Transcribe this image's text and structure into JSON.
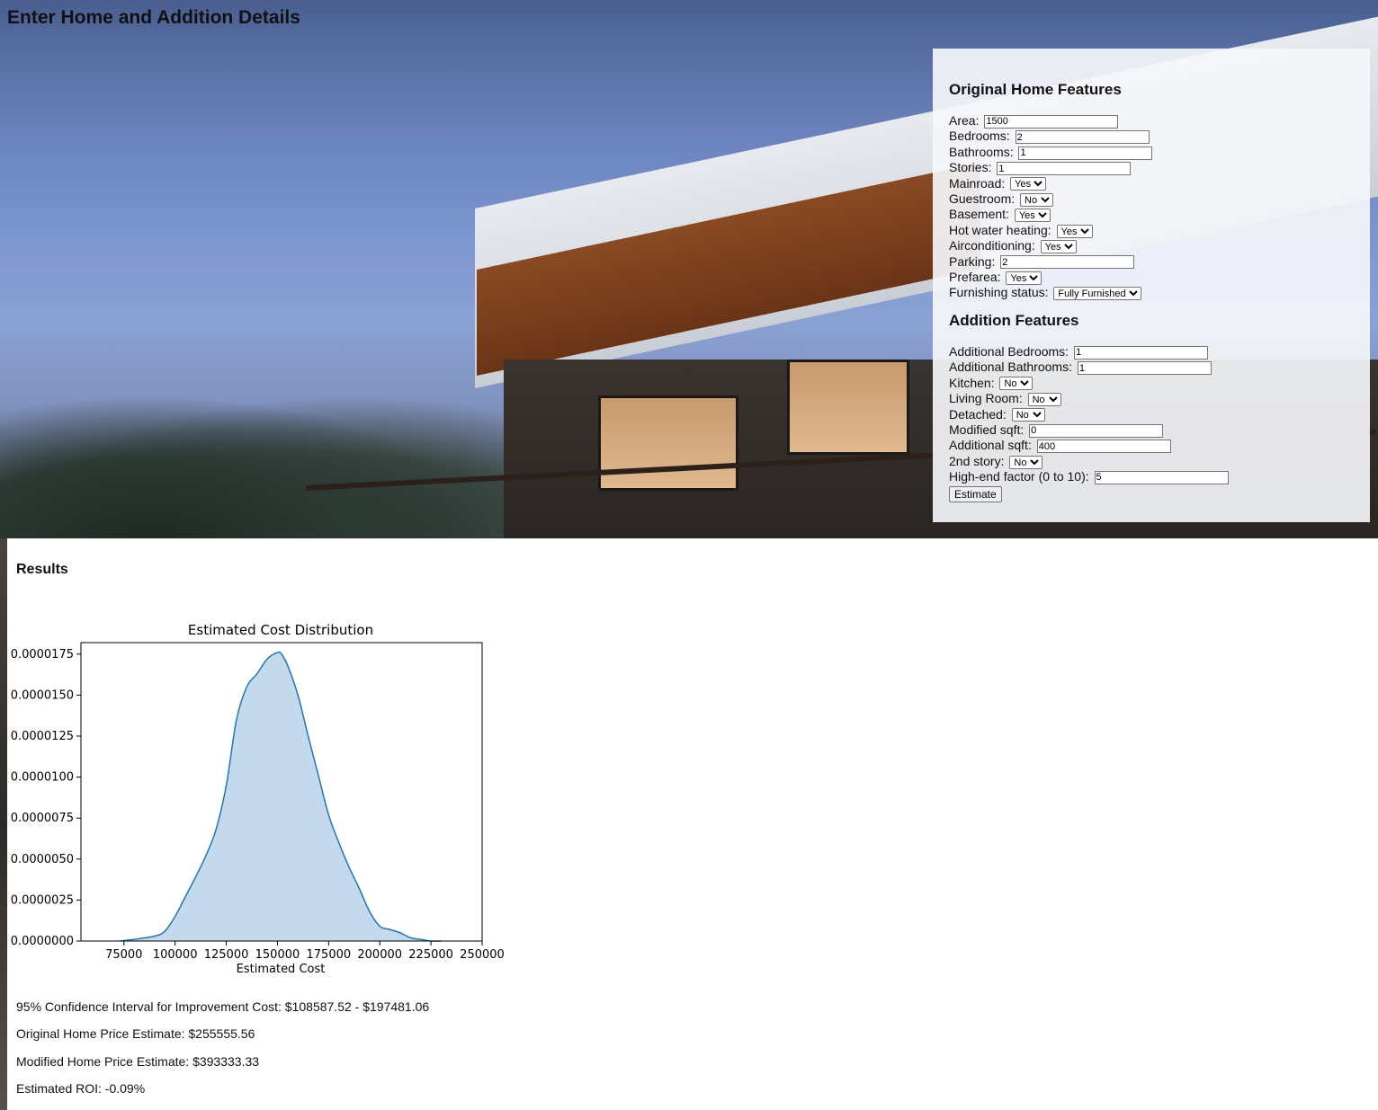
{
  "page": {
    "title": "Enter Home and Addition Details"
  },
  "original": {
    "heading": "Original Home Features",
    "fields": [
      {
        "label": "Area:",
        "type": "text",
        "value": "1500",
        "name": "area"
      },
      {
        "label": "Bedrooms:",
        "type": "text",
        "value": "2",
        "name": "bedrooms"
      },
      {
        "label": "Bathrooms:",
        "type": "text",
        "value": "1",
        "name": "bathrooms"
      },
      {
        "label": "Stories:",
        "type": "text",
        "value": "1",
        "name": "stories"
      },
      {
        "label": "Mainroad:",
        "type": "select",
        "value": "Yes",
        "name": "mainroad"
      },
      {
        "label": "Guestroom:",
        "type": "select",
        "value": "No",
        "name": "guestroom"
      },
      {
        "label": "Basement:",
        "type": "select",
        "value": "Yes",
        "name": "basement"
      },
      {
        "label": "Hot water heating:",
        "type": "select",
        "value": "Yes",
        "name": "hot-water-heating"
      },
      {
        "label": "Airconditioning:",
        "type": "select",
        "value": "Yes",
        "name": "airconditioning"
      },
      {
        "label": "Parking:",
        "type": "text",
        "value": "2",
        "name": "parking"
      },
      {
        "label": "Prefarea:",
        "type": "select",
        "value": "Yes",
        "name": "prefarea"
      },
      {
        "label": "Furnishing status:",
        "type": "select",
        "value": "Fully Furnished",
        "name": "furnishing-status"
      }
    ]
  },
  "addition": {
    "heading": "Addition Features",
    "fields": [
      {
        "label": "Additional Bedrooms:",
        "type": "text",
        "value": "1",
        "name": "additional-bedrooms"
      },
      {
        "label": "Additional Bathrooms:",
        "type": "text",
        "value": "1",
        "name": "additional-bathrooms"
      },
      {
        "label": "Kitchen:",
        "type": "select",
        "value": "No",
        "name": "kitchen"
      },
      {
        "label": "Living Room:",
        "type": "select",
        "value": "No",
        "name": "living-room"
      },
      {
        "label": "Detached:",
        "type": "select",
        "value": "No",
        "name": "detached"
      },
      {
        "label": "Modified sqft:",
        "type": "text",
        "value": "0",
        "name": "modified-sqft"
      },
      {
        "label": "Additional sqft:",
        "type": "text",
        "value": "400",
        "name": "additional-sqft"
      },
      {
        "label": "2nd story:",
        "type": "select",
        "value": "No",
        "name": "second-story"
      },
      {
        "label": "High-end factor (0 to 10):",
        "type": "text",
        "value": "5",
        "name": "high-end-factor"
      }
    ],
    "button_label": "Estimate"
  },
  "results": {
    "heading": "Results",
    "confidence_interval": "95% Confidence Interval for Improvement Cost: $108587.52 - $197481.06",
    "original_price": "Original Home Price Estimate: $255555.56",
    "modified_price": "Modified Home Price Estimate: $393333.33",
    "roi": "Estimated ROI: -0.09%"
  },
  "chart_data": {
    "type": "area",
    "title": "Estimated Cost Distribution",
    "xlabel": "Estimated Cost",
    "ylabel": "",
    "xlim": [
      54000,
      250000
    ],
    "ylim": [
      0,
      1.82e-05
    ],
    "xticks": [
      75000,
      100000,
      125000,
      150000,
      175000,
      200000,
      225000,
      250000
    ],
    "yticks": [
      "0.0000000",
      "0.0000025",
      "0.0000050",
      "0.0000075",
      "0.0000100",
      "0.0000125",
      "0.0000150",
      "0.0000175"
    ],
    "color": "#1f77b4",
    "fill": "#c4d9eb",
    "x": [
      73000,
      80000,
      90000,
      95000,
      100000,
      105000,
      110000,
      115000,
      120000,
      125000,
      130000,
      135000,
      140000,
      145000,
      150000,
      152000,
      155000,
      160000,
      165000,
      170000,
      175000,
      180000,
      185000,
      190000,
      195000,
      200000,
      205000,
      210000,
      215000,
      220000,
      225000,
      230000
    ],
    "y": [
      0.0,
      1e-07,
      3e-07,
      6e-07,
      1.5e-06,
      2.7e-06,
      3.9e-06,
      5.2e-06,
      6.8e-06,
      9.5e-06,
      1.35e-05,
      1.55e-05,
      1.63e-05,
      1.72e-05,
      1.76e-05,
      1.75e-05,
      1.68e-05,
      1.5e-05,
      1.25e-05,
      1.01e-05,
      7.7e-06,
      6e-06,
      4.5e-06,
      3.2e-06,
      1.8e-06,
      9e-07,
      7e-07,
      5e-07,
      2e-07,
      1e-07,
      0.0,
      0.0
    ]
  }
}
